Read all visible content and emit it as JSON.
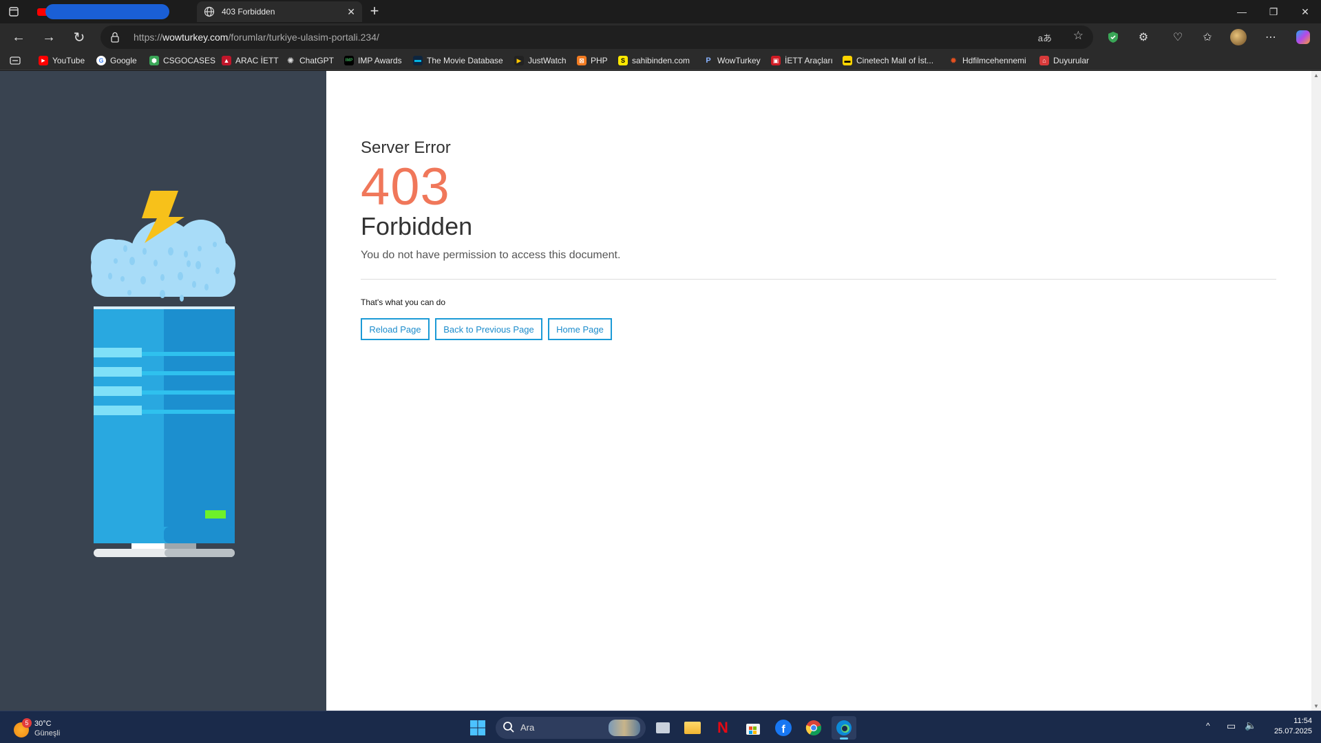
{
  "browser": {
    "tabs": [
      {
        "label": ""
      },
      {
        "label": "403 Forbidden"
      }
    ],
    "url_prefix": "https://",
    "url_domain": "wowturkey.com",
    "url_path": "/forumlar/turkiye-ulasim-portali.234/",
    "bookmarks": [
      {
        "label": "YouTube",
        "icon": "youtube-icon",
        "color": "#ff0000"
      },
      {
        "label": "Google",
        "icon": "google-icon",
        "color": "#ffffff"
      },
      {
        "label": "CSGOCASES",
        "icon": "csgocases-icon",
        "color": "#3aa657"
      },
      {
        "label": "ARAC İETT",
        "icon": "iett-icon",
        "color": "#c0162a"
      },
      {
        "label": "ChatGPT",
        "icon": "chatgpt-icon",
        "color": "#555555"
      },
      {
        "label": "IMP Awards",
        "icon": "imp-awards-icon",
        "color": "#000000"
      },
      {
        "label": "The Movie Database",
        "icon": "tmdb-icon",
        "color": "#0d253f"
      },
      {
        "label": "JustWatch",
        "icon": "justwatch-icon",
        "color": "#222222"
      },
      {
        "label": "PHP",
        "icon": "php-icon",
        "color": "#f27b21"
      },
      {
        "label": "sahibinden.com",
        "icon": "sahibinden-icon",
        "color": "#ffe800"
      },
      {
        "label": "WowTurkey",
        "icon": "wowturkey-icon",
        "color": "#2b2b2b"
      },
      {
        "label": "İETT Araçları",
        "icon": "iett-araclari-icon",
        "color": "#d01b24"
      },
      {
        "label": "Cinetech Mall of İst...",
        "icon": "cinetech-icon",
        "color": "#ffd400"
      },
      {
        "label": "Hdfilmcehennemi",
        "icon": "hdfilm-icon",
        "color": "#e5501f"
      },
      {
        "label": "Duyurular",
        "icon": "duyurular-icon",
        "color": "#d83a3a"
      }
    ]
  },
  "page": {
    "server_error": "Server Error",
    "code": "403",
    "title": "Forbidden",
    "message": "You do not have permission to access this document.",
    "actions_heading": "That's what you can do",
    "buttons": [
      "Reload Page",
      "Back to Previous Page",
      "Home Page"
    ],
    "accent_color": "#f0775a",
    "button_color": "#1b9ad6"
  },
  "taskbar": {
    "weather_temp": "30°C",
    "weather_desc": "Güneşli",
    "weather_badge": "5",
    "search_placeholder": "Ara",
    "time": "11:54",
    "date": "25.07.2025"
  }
}
